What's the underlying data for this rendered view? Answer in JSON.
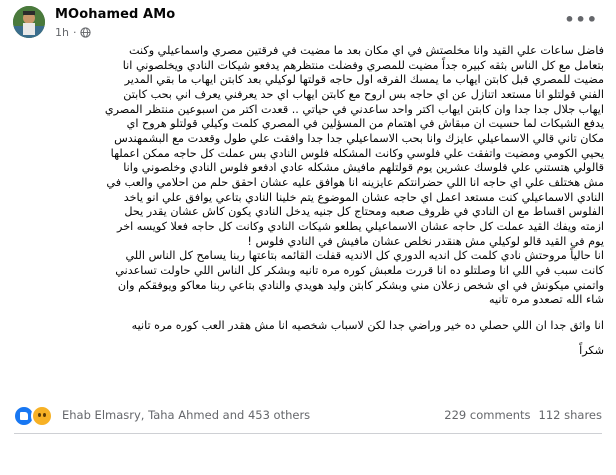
{
  "post": {
    "author_name": "MOohamed AMo",
    "timestamp": "1h",
    "privacy_icon": "globe-icon",
    "more_icon": "more-options-icon",
    "lines": [
      "فاضل ساعات علي القيد وانا مخلصتش في اي مكان بعد ما مضيت في فرقتين مصري واسماعيلي وكنت",
      "بتعامل مع كل الناس بثقه كبيره جداً مضيت للمصري وفضلت منتظرهم يدفعو شيكات النادي ويخلصوني  انا",
      "مضيت للمصري قبل كابتن ايهاب ما يمسك الفرقه  اول حاجه قولتها لوكيلي  بعد كابتن ايهاب ما بقي المدير",
      "الفني قولتلو انا مستعد اتنازل عن اي حاجه بس اروح مع كابتن ايهاب اي حد يعرفني يعرف اني بحب كابتن",
      "ايهاب جلال جدا جدا وان كابتن ايهاب اكتر واحد ساعدني في حياتي .. قعدت اكتر من اسبوعين منتظر المصري",
      "يدفع الشيكات لما حسيت ان مبقاش في اهتمام من المسؤلين في المصري كلمت وكيلي قولتلو هروح اي",
      "مكان تاني قالي الاسماعيلي عايزك وانا بحب الاسماعيلي جدا جدا وافقت علي طول وقعدت مع البشمهندس",
      "يحيي الكومي  ومضيت واتفقت علي فلوسي وكانت المشكله فلوس النادي بس عملت كل حاجه ممكن اعملها",
      "قالولي هتستني علي فلوسك عشرين يوم قولتلهم مافيش مشكله عادي ادفعو فلوس النادي وخلصوني وانا",
      "مش هختلف علي اي حاجه انا اللي حضرانتكم عايزينه انا هوافق عليه عشان احقق حلم من احلامي والعب في",
      "النادي الاسماعيلي كنت مستعد اعمل اي حاجه عشان الموضوع يتم خلينا النادي بتاعي يوافق علي انو ياخد",
      "الفلوس اقساط مع ان النادي في ظروف صعبه ومحتاج كل جنيه يدخل النادي يكون كاش عشان يقدر يحل",
      "ازمته ويفك القيد عملت كل حاجه عشان الاسماعيلي يطلعو شيكات النادي وكانت كل حاجه فعلا كويسه اخر",
      "يوم في القيد قالو لوكيلي مش هنقدر نخلص عشان مافيش في النادي فلوس !",
      "انا حالياً مروحتش نادي كلمت كل انديه الدوري كل الانديه قفلت    القائمه بتاعتها ربنا يسامح كل الناس اللي",
      "كانت سبب في  اللي انا وصلتلو ده انا قررت ملعبش كوره مره تانيه وبشكر كل الناس اللي حاولت تساعدني",
      "واتمني ميكونش في اي شخص زعلان مني وبشكر كابتن وليد هويدي والنادي بتاعي ربنا معاكو ويوفقكم وان",
      "شاء الله تصعدو مره تانيه",
      "انا واثق جدا ان اللي حصلي ده خير وراضي جدا لكن لاسباب شخصيه انا مش هقدر العب كوره مره تانيه",
      "شكراً"
    ]
  },
  "footer": {
    "reactors_text": "Ehab Elmasry, Taha Ahmed and 453 others",
    "comments": "229 comments",
    "shares": "112 shares"
  }
}
